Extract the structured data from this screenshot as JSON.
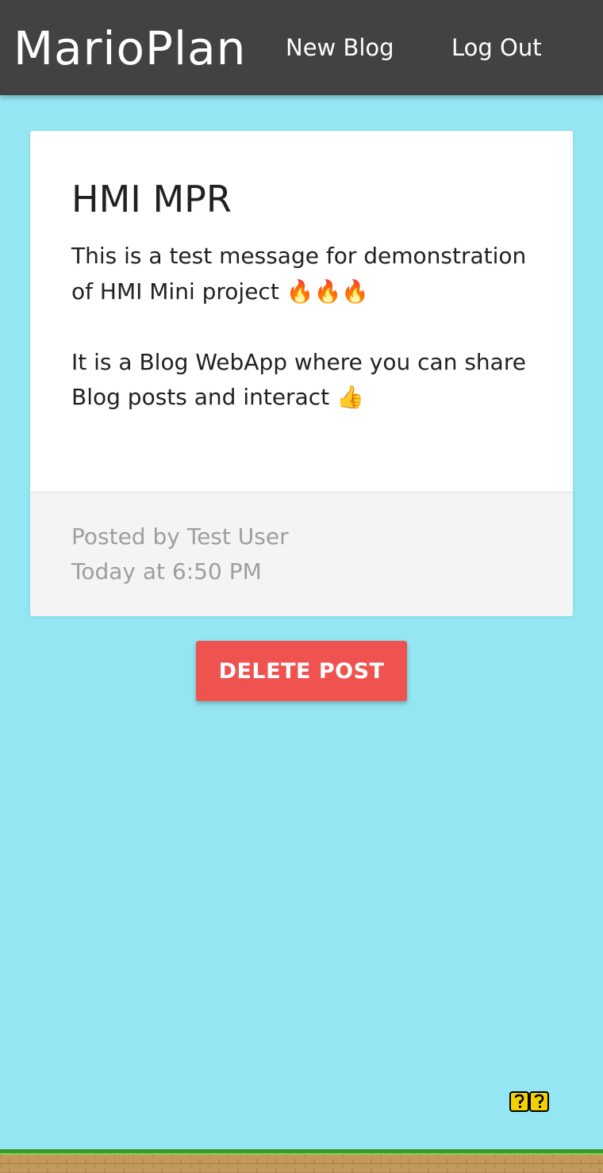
{
  "navbar": {
    "brand": "MarioPlan",
    "links": [
      {
        "label": "New Blog"
      },
      {
        "label": "Log Out"
      }
    ]
  },
  "post": {
    "title": "HMI MPR",
    "paragraphs": [
      "This is a test message for demonstration of HMI Mini project 🔥🔥🔥",
      "It is a Blog WebApp where you can share Blog posts and interact 👍"
    ],
    "author_line": "Posted by Test User",
    "timestamp": "Today at 6:50 PM"
  },
  "actions": {
    "delete_label": "DELETE POST"
  },
  "icons": {
    "question_blocks": "question-block-icon",
    "ground": "brick-ground"
  },
  "colors": {
    "background": "#94e6f2",
    "navbar": "#424242",
    "delete_button": "#ef5350",
    "card_action": "#f4f4f4",
    "grass": "#3a9a2a",
    "dirt": "#c49a5c"
  }
}
